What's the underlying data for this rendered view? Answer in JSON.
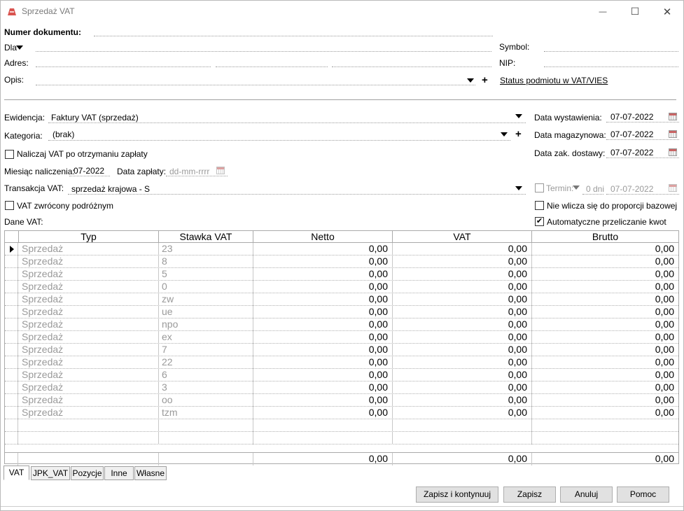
{
  "window": {
    "title": "Sprzedaż VAT",
    "minimize": "—",
    "maximize": "☐",
    "close": "✕"
  },
  "header": {
    "doc_number_label": "Numer dokumentu:",
    "for_label": "Dla",
    "address_label": "Adres:",
    "description_label": "Opis:",
    "symbol_label": "Symbol:",
    "nip_label": "NIP:",
    "vies_link": "Status podmiotu w VAT/VIES"
  },
  "form": {
    "ewidencja_label": "Ewidencja:",
    "ewidencja_value": "Faktury VAT (sprzedaż)",
    "kategoria_label": "Kategoria:",
    "kategoria_value": "(brak)",
    "vat_after_payment_label": "Naliczaj VAT po otrzymaniu zapłaty",
    "month_label": "Miesiąc naliczenia:",
    "month_value": "07-2022",
    "payment_date_label": "Data zapłaty:",
    "payment_date_placeholder": "dd-mm-rrrr",
    "transaction_label": "Transakcja VAT:",
    "transaction_value": "sprzedaż krajowa - S",
    "vat_returned_label": "VAT zwrócony podróżnym",
    "vat_data_label": "Dane VAT:",
    "issue_date_label": "Data wystawienia:",
    "issue_date_value": "07-07-2022",
    "warehouse_date_label": "Data magazynowa:",
    "warehouse_date_value": "07-07-2022",
    "delivery_date_label": "Data zak. dostawy:",
    "delivery_date_value": "07-07-2022",
    "termin_label": "Termin:",
    "termin_days": "0 dni",
    "termin_date": "07-07-2022",
    "not_in_proportion_label": "Nie wlicza się do proporcji bazowej",
    "auto_recalc_label": "Automatyczne przeliczanie kwot",
    "auto_recalc_checked": "✔"
  },
  "grid": {
    "columns": [
      "Typ",
      "Stawka VAT",
      "Netto",
      "VAT",
      "Brutto"
    ],
    "rows": [
      {
        "typ": "Sprzedaż",
        "stawka": "23",
        "netto": "0,00",
        "vat": "0,00",
        "brutto": "0,00"
      },
      {
        "typ": "Sprzedaż",
        "stawka": "8",
        "netto": "0,00",
        "vat": "0,00",
        "brutto": "0,00"
      },
      {
        "typ": "Sprzedaż",
        "stawka": "5",
        "netto": "0,00",
        "vat": "0,00",
        "brutto": "0,00"
      },
      {
        "typ": "Sprzedaż",
        "stawka": "0",
        "netto": "0,00",
        "vat": "0,00",
        "brutto": "0,00"
      },
      {
        "typ": "Sprzedaż",
        "stawka": "zw",
        "netto": "0,00",
        "vat": "0,00",
        "brutto": "0,00"
      },
      {
        "typ": "Sprzedaż",
        "stawka": "ue",
        "netto": "0,00",
        "vat": "0,00",
        "brutto": "0,00"
      },
      {
        "typ": "Sprzedaż",
        "stawka": "npo",
        "netto": "0,00",
        "vat": "0,00",
        "brutto": "0,00"
      },
      {
        "typ": "Sprzedaż",
        "stawka": "ex",
        "netto": "0,00",
        "vat": "0,00",
        "brutto": "0,00"
      },
      {
        "typ": "Sprzedaż",
        "stawka": "7",
        "netto": "0,00",
        "vat": "0,00",
        "brutto": "0,00"
      },
      {
        "typ": "Sprzedaż",
        "stawka": "22",
        "netto": "0,00",
        "vat": "0,00",
        "brutto": "0,00"
      },
      {
        "typ": "Sprzedaż",
        "stawka": "6",
        "netto": "0,00",
        "vat": "0,00",
        "brutto": "0,00"
      },
      {
        "typ": "Sprzedaż",
        "stawka": "3",
        "netto": "0,00",
        "vat": "0,00",
        "brutto": "0,00"
      },
      {
        "typ": "Sprzedaż",
        "stawka": "oo",
        "netto": "0,00",
        "vat": "0,00",
        "brutto": "0,00"
      },
      {
        "typ": "Sprzedaż",
        "stawka": "tzm",
        "netto": "0,00",
        "vat": "0,00",
        "brutto": "0,00"
      }
    ],
    "totals": {
      "netto": "0,00",
      "vat": "0,00",
      "brutto": "0,00"
    }
  },
  "tabs": [
    "VAT",
    "JPK_VAT",
    "Pozycje",
    "Inne",
    "Własne"
  ],
  "buttons": {
    "save_continue": "Zapisz i kontynuuj",
    "save": "Zapisz",
    "cancel": "Anuluj",
    "help": "Pomoc"
  }
}
